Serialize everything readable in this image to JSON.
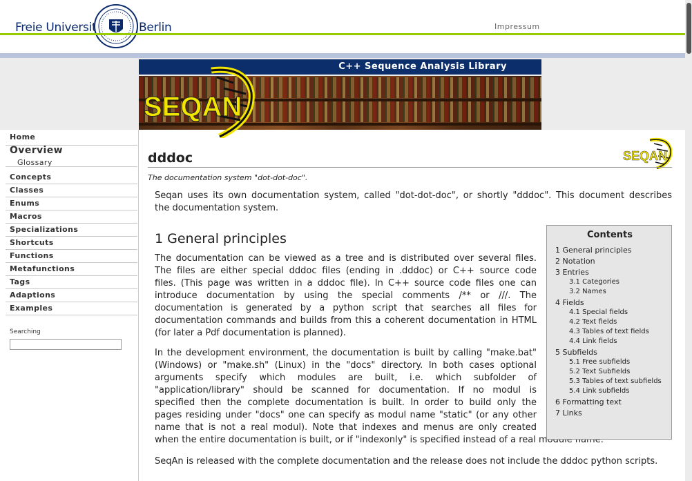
{
  "header": {
    "wordmark_left": "Freie Universität",
    "wordmark_right": "Berlin",
    "impressum": "Impressum"
  },
  "banner": {
    "title": "C++ Sequence Analysis Library",
    "logo_text": "SEQAN"
  },
  "sidebar": {
    "items": [
      {
        "label": "Home"
      },
      {
        "label": "Overview"
      },
      {
        "label": "Glossary"
      },
      {
        "label": "Concepts"
      },
      {
        "label": "Classes"
      },
      {
        "label": "Enums"
      },
      {
        "label": "Macros"
      },
      {
        "label": "Specializations"
      },
      {
        "label": "Shortcuts"
      },
      {
        "label": "Functions"
      },
      {
        "label": "Metafunctions"
      },
      {
        "label": "Tags"
      },
      {
        "label": "Adaptions"
      },
      {
        "label": "Examples"
      }
    ],
    "search_label": "Searching",
    "search_value": ""
  },
  "main": {
    "title": "dddoc",
    "subtitle": "The documentation system \"dot-dot-doc\".",
    "intro_lines": [
      "Seqan uses its own documentation system, called \"dot-dot-doc\", or shortly \"dddoc\". This document describes",
      "the documentation system."
    ],
    "section1_heading": "1 General principles",
    "para1_lines": [
      "The documentation can be viewed as a tree and is distributed over several files.",
      "The files are either special dddoc files (ending in .dddoc) or C++ source code",
      "files. (This page was written in a dddoc file). In C++ source code files one can",
      "introduce documentation by using the special comments /** or ///. The",
      "documentation is generated by a python script that searches all files for",
      "documentation commands and builds from this a coherent documentation in HTML",
      "(for later a Pdf documentation is planned)."
    ],
    "para2_lines": [
      "In the development environment, the documentation is built by calling \"make.bat\"",
      "(Windows) or \"make.sh\" (Linux) in the \"docs\" directory. In both cases optional",
      "arguments specify which modules are built, i.e. which subfolder of",
      "\"application/library\" should be scanned for documentation. If no modul is",
      "specified then the complete documentation is built. In order to build only the",
      "pages residing under \"docs\" one can specify as modul name \"static\" (or any other",
      "name that is not a real modul). Note that indexes and menus are only created",
      "when the entire documentation is built, or if \"indexonly\" is specified instead of a real module name."
    ],
    "para3": "SeqAn is released with the complete documentation and the release does not include the dddoc python scripts."
  },
  "toc": {
    "title": "Contents",
    "items": [
      {
        "label": "1 General principles"
      },
      {
        "label": "2 Notation"
      },
      {
        "label": "3 Entries"
      },
      {
        "label": "3.1 Categories"
      },
      {
        "label": "3.2 Names"
      },
      {
        "label": "4 Fields"
      },
      {
        "label": "4.1 Special fields"
      },
      {
        "label": "4.2 Text fields"
      },
      {
        "label": "4.3 Tables of text fields"
      },
      {
        "label": "4.4 Link fields"
      },
      {
        "label": "5 Subfields"
      },
      {
        "label": "5.1 Free subfields"
      },
      {
        "label": "5.2 Text Subfields"
      },
      {
        "label": "5.3 Tables of text subfields"
      },
      {
        "label": "5.4 Link subfields"
      },
      {
        "label": "6 Formatting text"
      },
      {
        "label": "7 Links"
      }
    ]
  },
  "colors": {
    "fu_blue": "#0a2a6b",
    "fu_green": "#99cc00",
    "banner_bar": "#0c2f6b",
    "logo_yellow": "#f2e600"
  }
}
